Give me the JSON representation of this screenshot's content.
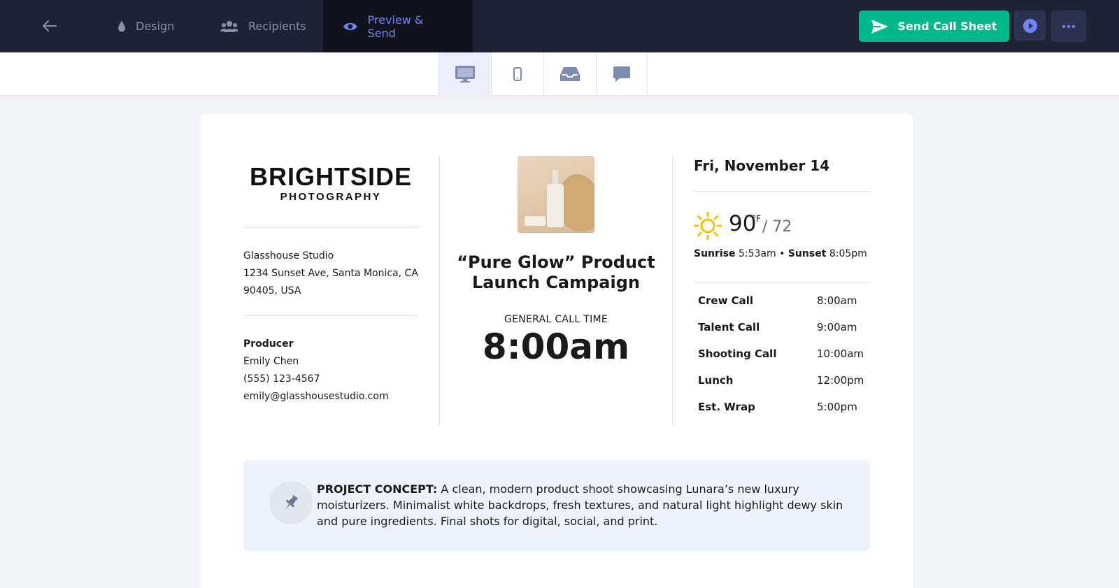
{
  "nav": {
    "tabs": [
      {
        "label": "Design"
      },
      {
        "label": "Recipients"
      },
      {
        "label": "Preview & Send"
      }
    ],
    "send_label": "Send Call Sheet"
  },
  "colors": {
    "topbar": "#1f2233",
    "accent_blue": "#6f86f2",
    "send_green": "#00b889"
  },
  "icons": [
    "back-arrow-icon",
    "droplet-icon",
    "people-icon",
    "eye-icon",
    "paper-plane-icon",
    "play-icon",
    "more-icon",
    "desktop-icon",
    "mobile-icon",
    "inbox-icon",
    "chat-icon",
    "sun-icon",
    "pin-icon"
  ],
  "company": {
    "name": "BRIGHTSIDE",
    "sub": "PHOTOGRAPHY"
  },
  "location": {
    "name": "Glasshouse Studio",
    "address1": "1234 Sunset Ave, Santa Monica, CA",
    "address2": "90405, USA"
  },
  "producer": {
    "heading": "Producer",
    "name": "Emily Chen",
    "phone": "(555) 123-4567",
    "email": "emily@glasshousestudio.com"
  },
  "project": {
    "title_line1": "“Pure Glow” Product",
    "title_line2": "Launch Campaign",
    "call_label": "GENERAL CALL TIME",
    "call_time": "8:00am"
  },
  "day": {
    "date": "Fri, November 14",
    "temp_high": "90",
    "temp_unit": "°F",
    "temp_low": "/ 72",
    "sunrise_label": "Sunrise",
    "sunrise": "5:53am",
    "sep": "•",
    "sunset_label": "Sunset",
    "sunset": "8:05pm"
  },
  "schedule": [
    {
      "label": "Crew Call",
      "time": "8:00am"
    },
    {
      "label": "Talent Call",
      "time": "9:00am"
    },
    {
      "label": "Shooting Call",
      "time": "10:00am"
    },
    {
      "label": "Lunch",
      "time": "12:00pm"
    },
    {
      "label": "Est. Wrap",
      "time": "5:00pm"
    }
  ],
  "concept": {
    "label": "PROJECT CONCEPT:",
    "text": "A clean, modern product shoot showcasing Lunara’s new luxury moisturizers. Minimalist white backdrops, fresh textures, and natural light highlight dewy skin and pure ingredients. Final shots for digital, social, and print."
  }
}
